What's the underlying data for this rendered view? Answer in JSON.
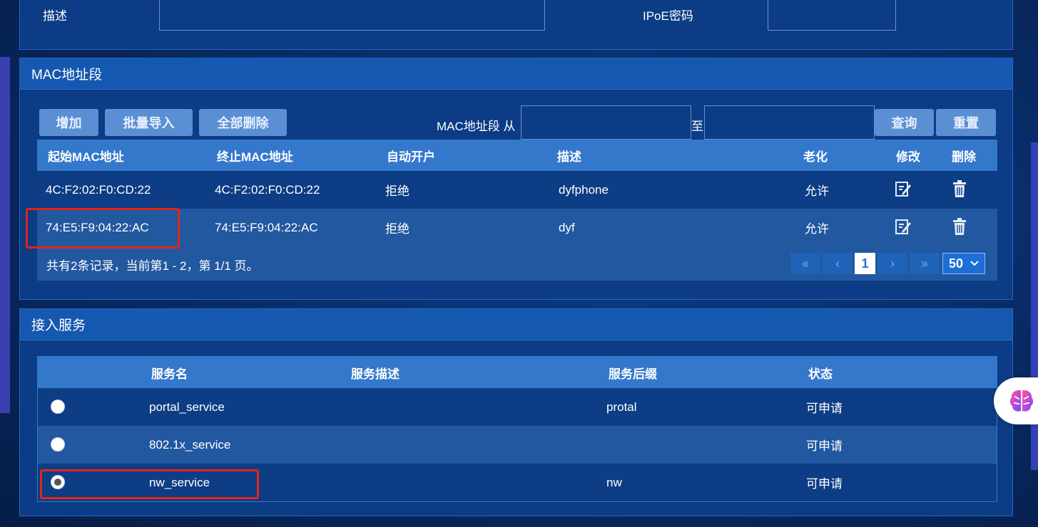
{
  "top_form": {
    "desc_label": "描述",
    "ipoe_label": "IPoE密码"
  },
  "mac_panel": {
    "title": "MAC地址段",
    "buttons": {
      "add": "增加",
      "import": "批量导入",
      "delete_all": "全部删除",
      "query": "查询",
      "reset": "重置"
    },
    "range_label": "MAC地址段 从",
    "to_label": "至",
    "columns": [
      "起始MAC地址",
      "终止MAC地址",
      "自动开户",
      "描述",
      "老化",
      "修改",
      "删除"
    ],
    "rows": [
      {
        "start": "4C:F2:02:F0:CD:22",
        "end": "4C:F2:02:F0:CD:22",
        "auto": "拒绝",
        "desc": "dyfphone",
        "aging": "允许"
      },
      {
        "start": "74:E5:F9:04:22:AC",
        "end": "74:E5:F9:04:22:AC",
        "auto": "拒绝",
        "desc": "dyf",
        "aging": "允许"
      }
    ],
    "summary": "共有2条记录，当前第1 - 2，第 1/1 页。",
    "pager": {
      "first": "«",
      "prev": "‹",
      "current": "1",
      "next": "›",
      "last": "»",
      "page_size": "50"
    }
  },
  "service_panel": {
    "title": "接入服务",
    "columns": [
      "服务名",
      "服务描述",
      "服务后缀",
      "状态"
    ],
    "rows": [
      {
        "name": "portal_service",
        "desc": "",
        "suffix": "protal",
        "status": "可申请",
        "selected": false
      },
      {
        "name": "802.1x_service",
        "desc": "",
        "suffix": "",
        "status": "可申请",
        "selected": false
      },
      {
        "name": "nw_service",
        "desc": "",
        "suffix": "nw",
        "status": "可申请",
        "selected": true
      }
    ]
  },
  "icons": {
    "edit": "edit-icon",
    "delete": "trash-icon",
    "assistant": "brain-icon"
  },
  "colors": {
    "panel": "#0b3c85",
    "header": "#3478cc",
    "highlight": "#e5221c",
    "button": "#5a8fd4"
  }
}
